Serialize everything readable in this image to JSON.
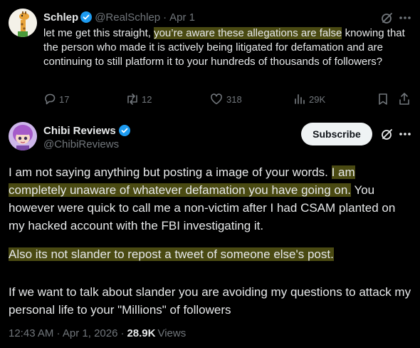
{
  "reply": {
    "author_name": "Schlep",
    "handle": "@RealSchlep",
    "sep": "·",
    "date": "Apr 1",
    "text_before": "let me get this straight, ",
    "text_highlight": "you’re aware these allegations are false",
    "text_after": " knowing that the person who made it is actively being litigated for defamation and are continuing to still platform it to your hundreds of thousands of followers?",
    "actions": {
      "replies": "17",
      "reposts": "12",
      "likes": "318",
      "views": "29K"
    }
  },
  "main": {
    "author_name": "Chibi Reviews",
    "handle": "@ChibiReviews",
    "subscribe_label": "Subscribe",
    "p1_before": "I am not saying anything but posting a image of your words. ",
    "p1_highlight": "I am completely unaware of whatever defamation you have going on.",
    "p1_after": " You however were quick to call me a non-victim after I had CSAM planted on my hacked account with the FBI investigating it.",
    "p2_highlight": "Also its not slander to repost a tweet of someone else's post.",
    "p3": "If we want to talk about slander you are avoiding my questions to attack my personal life to your \"Millions\" of followers",
    "time": "12:43 AM · Apr 1, 2026",
    "sep": "·",
    "views_count": "28.9K",
    "views_label": "Views"
  },
  "colors": {
    "verified": "#1d9bf0",
    "highlight": "#4a4a12",
    "muted": "#71767b"
  }
}
